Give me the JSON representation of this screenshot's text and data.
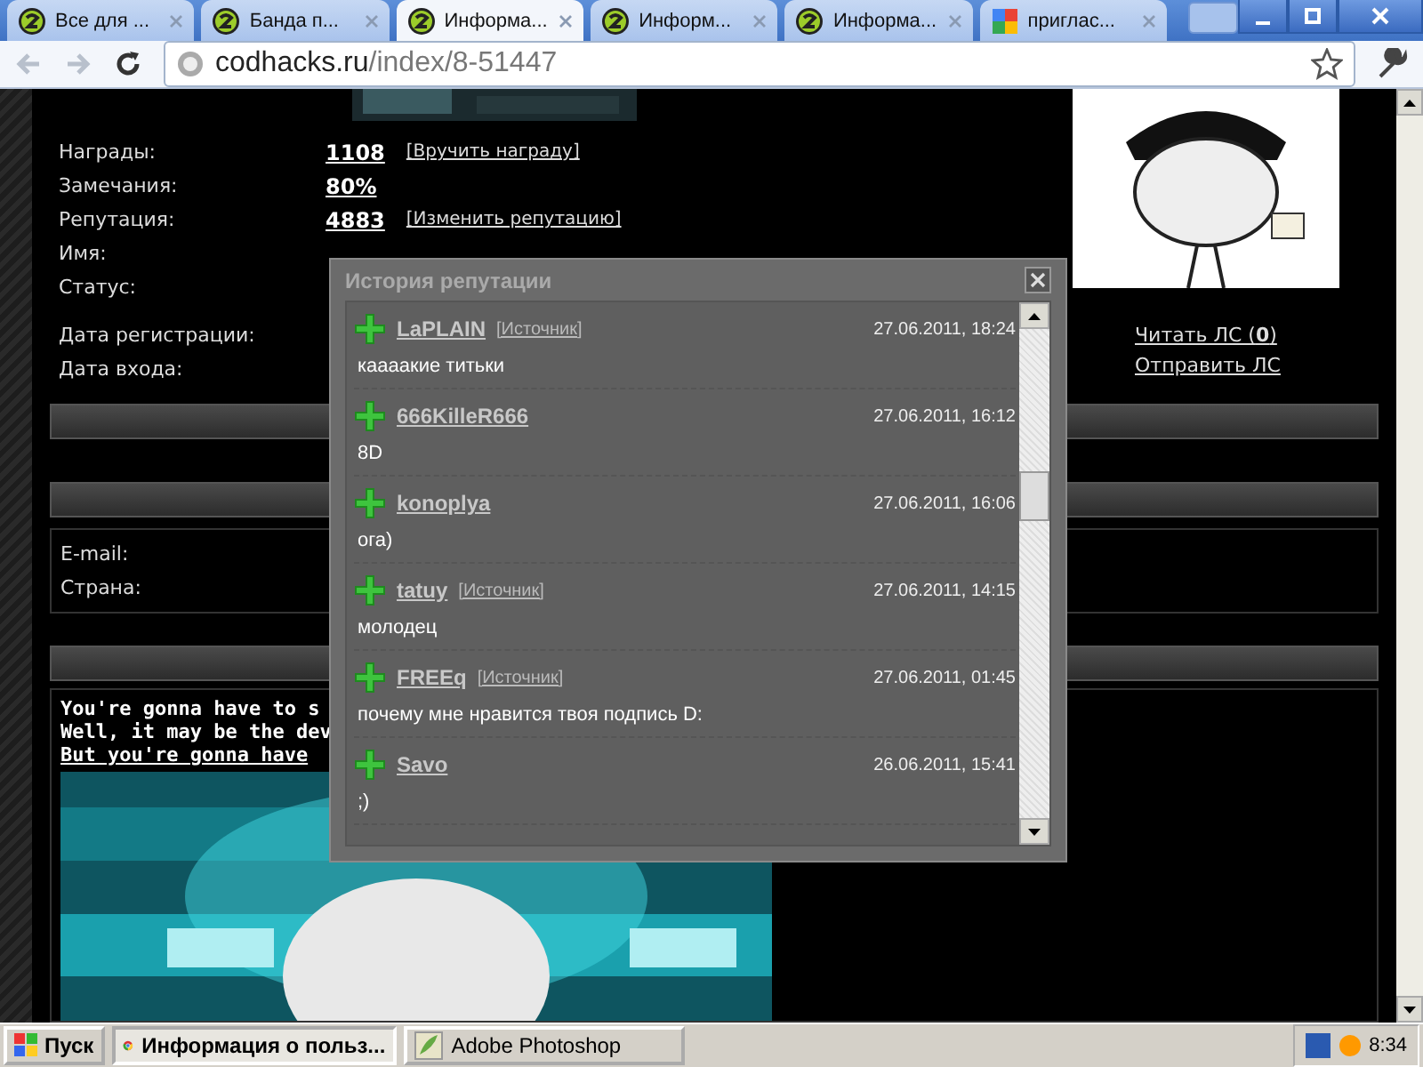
{
  "browser": {
    "tabs": [
      {
        "title": "Все для ...",
        "kind": "site",
        "selected": false
      },
      {
        "title": "Банда п...",
        "kind": "site",
        "selected": false
      },
      {
        "title": "Информа...",
        "kind": "site",
        "selected": true
      },
      {
        "title": "Информ...",
        "kind": "site",
        "selected": false
      },
      {
        "title": "Информа...",
        "kind": "site",
        "selected": false
      },
      {
        "title": "приглас...",
        "kind": "google",
        "selected": false
      }
    ],
    "address": {
      "host": "codhacks.ru",
      "path": "/index/8-51447"
    }
  },
  "profile": {
    "rows": [
      {
        "label": "Награды:",
        "value": "1108",
        "link": "[Вручить награду]"
      },
      {
        "label": "Замечания:",
        "value": "80%"
      },
      {
        "label": "Репутация:",
        "value": "4883",
        "link": "[Изменить репутацию]"
      },
      {
        "label": "Имя:"
      },
      {
        "label": "Статус:"
      },
      {
        "label": "Дата регистрации:"
      },
      {
        "label": "Дата входа:"
      }
    ],
    "message_links": [
      "Читать ЛС (**0**)",
      "Отправить ЛС"
    ],
    "contacts": [
      "E-mail:",
      "Страна:"
    ],
    "signature": [
      {
        "text": "You're gonna have to s",
        "underlined": false
      },
      {
        "text": "Well, it may be the dev",
        "underlined": false
      },
      {
        "text": "But you're gonna have",
        "underlined": true
      }
    ]
  },
  "dialog": {
    "title": "История репутации",
    "entries": [
      {
        "user": "LaPLAIN",
        "source": "[Источник]",
        "date": "27.06.2011, 18:24",
        "comment": "каааакие титьки"
      },
      {
        "user": "666KilleR666",
        "date": "27.06.2011, 16:12",
        "comment": "8D"
      },
      {
        "user": "konoplya",
        "date": "27.06.2011, 16:06",
        "comment": "ога)"
      },
      {
        "user": "tatuy",
        "source": "[Источник]",
        "date": "27.06.2011, 14:15",
        "comment": "молодец"
      },
      {
        "user": "FREEq",
        "source": "[Источник]",
        "date": "27.06.2011, 01:45",
        "comment": "почему мне нравится твоя подпись D:"
      },
      {
        "user": "Savo",
        "date": "26.06.2011, 15:41",
        "comment": ";)"
      }
    ]
  },
  "taskbar": {
    "start": "Пуск",
    "tasks": [
      {
        "label": "Информация о польз...",
        "kind": "chrome",
        "selected": true
      },
      {
        "label": "Adobe Photoshop",
        "kind": "photoshop",
        "selected": false
      }
    ],
    "clock": "8:34"
  }
}
